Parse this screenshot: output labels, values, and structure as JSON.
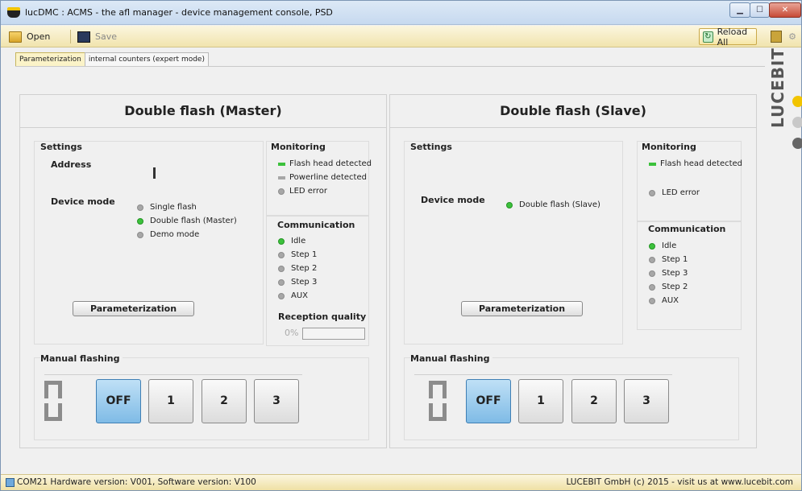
{
  "window": {
    "title": "lucDMC : ACMS - the afl manager - device management console, PSD"
  },
  "toolbar": {
    "open_label": "Open",
    "save_label": "Save",
    "reload_label": "Reload All"
  },
  "tabs": [
    {
      "label": "Parameterization",
      "active": true
    },
    {
      "label": "internal counters (expert mode)",
      "active": false
    }
  ],
  "logo": {
    "text": "LUCEBIT",
    "dot_colors": [
      "#f2c400",
      "#c8c8c8",
      "#666666"
    ]
  },
  "master": {
    "title": "Double flash (Master)",
    "settings": {
      "title": "Settings",
      "address_label": "Address",
      "device_mode_label": "Device mode",
      "modes": [
        {
          "label": "Single flash",
          "on": false
        },
        {
          "label": "Double flash (Master)",
          "on": true
        },
        {
          "label": "Demo mode",
          "on": false
        }
      ],
      "param_button": "Parameterization"
    },
    "monitoring": {
      "title": "Monitoring",
      "items": [
        {
          "label": "Flash head detected",
          "on": true
        },
        {
          "label": "Powerline detected",
          "on": false
        },
        {
          "label": "LED error",
          "on": false
        }
      ]
    },
    "communication": {
      "title": "Communication",
      "items": [
        {
          "label": "Idle",
          "on": true
        },
        {
          "label": "Step 1",
          "on": false
        },
        {
          "label": "Step 2",
          "on": false
        },
        {
          "label": "Step 3",
          "on": false
        },
        {
          "label": "AUX",
          "on": false
        }
      ],
      "reception_title": "Reception quality",
      "reception_value": "0%",
      "reception_fraction": 0
    },
    "manual": {
      "title": "Manual flashing",
      "buttons": [
        "OFF",
        "1",
        "2",
        "3"
      ],
      "active_button": "OFF"
    }
  },
  "slave": {
    "title": "Double flash (Slave)",
    "settings": {
      "title": "Settings",
      "device_mode_label": "Device mode",
      "mode": {
        "label": "Double flash (Slave)",
        "on": true
      },
      "param_button": "Parameterization"
    },
    "monitoring": {
      "title": "Monitoring",
      "items": [
        {
          "label": "Flash head detected",
          "on": true
        },
        {
          "label": "LED error",
          "on": false
        }
      ]
    },
    "communication": {
      "title": "Communication",
      "items": [
        {
          "label": "Idle",
          "on": true
        },
        {
          "label": "Step 1",
          "on": false
        },
        {
          "label": "Step 3",
          "on": false
        },
        {
          "label": "Step 2",
          "on": false
        },
        {
          "label": "AUX",
          "on": false
        }
      ]
    },
    "manual": {
      "title": "Manual flashing",
      "buttons": [
        "OFF",
        "1",
        "2",
        "3"
      ],
      "active_button": "OFF"
    }
  },
  "status": {
    "left": "COM21  Hardware version: V001, Software version: V100",
    "right": "LUCEBIT GmbH (c) 2015 - visit us at www.lucebit.com"
  }
}
